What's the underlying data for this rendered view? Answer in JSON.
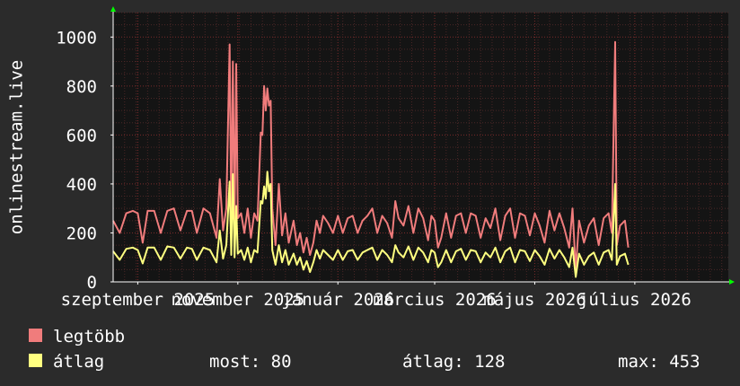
{
  "chart_data": {
    "type": "line",
    "ylabel": "onlinestream.live",
    "ylim": [
      0,
      1100
    ],
    "y_ticks": [
      0,
      200,
      400,
      600,
      800,
      1000
    ],
    "grid": true,
    "x_ticks": [
      {
        "label": "szeptember 2025",
        "t": 0.0
      },
      {
        "label": "november 2025",
        "t": 61.0
      },
      {
        "label": "január 2026",
        "t": 122.0
      },
      {
        "label": "március 2026",
        "t": 181.0
      },
      {
        "label": "május 2026",
        "t": 242.0
      },
      {
        "label": "július 2026",
        "t": 303.0
      }
    ],
    "x_range": [
      -15,
      360
    ],
    "series": [
      {
        "name": "legtöbb",
        "color": "#f07c7c",
        "points": [
          [
            -15,
            250
          ],
          [
            -11,
            200
          ],
          [
            -7,
            280
          ],
          [
            -3,
            290
          ],
          [
            0,
            280
          ],
          [
            3,
            160
          ],
          [
            6,
            290
          ],
          [
            10,
            290
          ],
          [
            14,
            200
          ],
          [
            18,
            290
          ],
          [
            22,
            300
          ],
          [
            26,
            210
          ],
          [
            30,
            290
          ],
          [
            33,
            290
          ],
          [
            36,
            200
          ],
          [
            40,
            300
          ],
          [
            44,
            280
          ],
          [
            48,
            180
          ],
          [
            50,
            420
          ],
          [
            52,
            210
          ],
          [
            54,
            300
          ],
          [
            56,
            970
          ],
          [
            57,
            250
          ],
          [
            58,
            900
          ],
          [
            59,
            220
          ],
          [
            60,
            890
          ],
          [
            61,
            260
          ],
          [
            63,
            280
          ],
          [
            65,
            200
          ],
          [
            67,
            300
          ],
          [
            69,
            180
          ],
          [
            71,
            280
          ],
          [
            73,
            250
          ],
          [
            75,
            610
          ],
          [
            76,
            600
          ],
          [
            77,
            800
          ],
          [
            78,
            700
          ],
          [
            79,
            790
          ],
          [
            80,
            720
          ],
          [
            81,
            740
          ],
          [
            82,
            300
          ],
          [
            84,
            150
          ],
          [
            86,
            400
          ],
          [
            88,
            190
          ],
          [
            90,
            280
          ],
          [
            92,
            160
          ],
          [
            95,
            250
          ],
          [
            97,
            150
          ],
          [
            99,
            200
          ],
          [
            101,
            120
          ],
          [
            103,
            180
          ],
          [
            105,
            110
          ],
          [
            107,
            160
          ],
          [
            109,
            250
          ],
          [
            111,
            200
          ],
          [
            113,
            270
          ],
          [
            116,
            240
          ],
          [
            119,
            200
          ],
          [
            122,
            270
          ],
          [
            125,
            200
          ],
          [
            128,
            260
          ],
          [
            131,
            270
          ],
          [
            134,
            200
          ],
          [
            137,
            250
          ],
          [
            140,
            270
          ],
          [
            143,
            300
          ],
          [
            146,
            200
          ],
          [
            149,
            270
          ],
          [
            152,
            240
          ],
          [
            155,
            180
          ],
          [
            157,
            330
          ],
          [
            159,
            260
          ],
          [
            162,
            230
          ],
          [
            165,
            310
          ],
          [
            168,
            200
          ],
          [
            171,
            300
          ],
          [
            174,
            260
          ],
          [
            177,
            170
          ],
          [
            179,
            270
          ],
          [
            181,
            250
          ],
          [
            183,
            140
          ],
          [
            185,
            180
          ],
          [
            188,
            280
          ],
          [
            191,
            180
          ],
          [
            194,
            270
          ],
          [
            197,
            280
          ],
          [
            200,
            200
          ],
          [
            203,
            280
          ],
          [
            206,
            270
          ],
          [
            209,
            180
          ],
          [
            212,
            260
          ],
          [
            215,
            220
          ],
          [
            218,
            300
          ],
          [
            221,
            170
          ],
          [
            224,
            270
          ],
          [
            227,
            300
          ],
          [
            230,
            180
          ],
          [
            233,
            280
          ],
          [
            236,
            270
          ],
          [
            239,
            190
          ],
          [
            242,
            280
          ],
          [
            245,
            230
          ],
          [
            248,
            160
          ],
          [
            251,
            290
          ],
          [
            254,
            210
          ],
          [
            257,
            280
          ],
          [
            260,
            220
          ],
          [
            263,
            140
          ],
          [
            265,
            300
          ],
          [
            267,
            50
          ],
          [
            269,
            250
          ],
          [
            272,
            160
          ],
          [
            275,
            230
          ],
          [
            278,
            260
          ],
          [
            281,
            150
          ],
          [
            284,
            260
          ],
          [
            287,
            280
          ],
          [
            289,
            200
          ],
          [
            291,
            980
          ],
          [
            292,
            150
          ],
          [
            294,
            230
          ],
          [
            297,
            250
          ],
          [
            299,
            140
          ]
        ]
      },
      {
        "name": "átlag",
        "color": "#ffff80",
        "points": [
          [
            -15,
            125
          ],
          [
            -11,
            90
          ],
          [
            -7,
            135
          ],
          [
            -3,
            140
          ],
          [
            0,
            130
          ],
          [
            3,
            75
          ],
          [
            6,
            140
          ],
          [
            10,
            140
          ],
          [
            14,
            90
          ],
          [
            18,
            145
          ],
          [
            22,
            140
          ],
          [
            26,
            95
          ],
          [
            30,
            140
          ],
          [
            33,
            135
          ],
          [
            36,
            90
          ],
          [
            40,
            140
          ],
          [
            44,
            130
          ],
          [
            48,
            80
          ],
          [
            50,
            210
          ],
          [
            52,
            95
          ],
          [
            54,
            150
          ],
          [
            56,
            410
          ],
          [
            57,
            110
          ],
          [
            58,
            440
          ],
          [
            59,
            100
          ],
          [
            60,
            310
          ],
          [
            61,
            115
          ],
          [
            63,
            130
          ],
          [
            65,
            90
          ],
          [
            67,
            140
          ],
          [
            69,
            80
          ],
          [
            71,
            130
          ],
          [
            73,
            120
          ],
          [
            75,
            330
          ],
          [
            76,
            320
          ],
          [
            77,
            390
          ],
          [
            78,
            340
          ],
          [
            79,
            450
          ],
          [
            80,
            370
          ],
          [
            81,
            400
          ],
          [
            82,
            130
          ],
          [
            84,
            70
          ],
          [
            86,
            150
          ],
          [
            88,
            80
          ],
          [
            90,
            130
          ],
          [
            92,
            70
          ],
          [
            95,
            115
          ],
          [
            97,
            70
          ],
          [
            99,
            100
          ],
          [
            101,
            50
          ],
          [
            103,
            85
          ],
          [
            105,
            40
          ],
          [
            107,
            80
          ],
          [
            109,
            130
          ],
          [
            111,
            95
          ],
          [
            113,
            130
          ],
          [
            116,
            110
          ],
          [
            119,
            90
          ],
          [
            122,
            130
          ],
          [
            125,
            90
          ],
          [
            128,
            125
          ],
          [
            131,
            130
          ],
          [
            134,
            90
          ],
          [
            137,
            120
          ],
          [
            140,
            130
          ],
          [
            143,
            140
          ],
          [
            146,
            90
          ],
          [
            149,
            130
          ],
          [
            152,
            110
          ],
          [
            155,
            80
          ],
          [
            157,
            150
          ],
          [
            159,
            120
          ],
          [
            162,
            100
          ],
          [
            165,
            145
          ],
          [
            168,
            90
          ],
          [
            171,
            140
          ],
          [
            174,
            120
          ],
          [
            177,
            80
          ],
          [
            179,
            130
          ],
          [
            181,
            120
          ],
          [
            183,
            60
          ],
          [
            185,
            80
          ],
          [
            188,
            130
          ],
          [
            191,
            80
          ],
          [
            194,
            125
          ],
          [
            197,
            135
          ],
          [
            200,
            90
          ],
          [
            203,
            130
          ],
          [
            206,
            125
          ],
          [
            209,
            80
          ],
          [
            212,
            120
          ],
          [
            215,
            100
          ],
          [
            218,
            140
          ],
          [
            221,
            80
          ],
          [
            224,
            125
          ],
          [
            227,
            140
          ],
          [
            230,
            80
          ],
          [
            233,
            130
          ],
          [
            236,
            125
          ],
          [
            239,
            85
          ],
          [
            242,
            130
          ],
          [
            245,
            105
          ],
          [
            248,
            70
          ],
          [
            251,
            135
          ],
          [
            254,
            95
          ],
          [
            257,
            130
          ],
          [
            260,
            100
          ],
          [
            263,
            60
          ],
          [
            265,
            140
          ],
          [
            267,
            20
          ],
          [
            269,
            115
          ],
          [
            272,
            70
          ],
          [
            275,
            105
          ],
          [
            278,
            120
          ],
          [
            281,
            70
          ],
          [
            284,
            120
          ],
          [
            287,
            130
          ],
          [
            289,
            90
          ],
          [
            291,
            400
          ],
          [
            292,
            70
          ],
          [
            294,
            105
          ],
          [
            297,
            115
          ],
          [
            299,
            70
          ]
        ]
      }
    ]
  },
  "legend": {
    "items": [
      {
        "label": "legtöbb",
        "color": "#f07c7c"
      },
      {
        "label": "átlag",
        "color": "#ffff80"
      }
    ]
  },
  "stats": {
    "now": "most: 80",
    "avg": "átlag: 128",
    "max": "max: 453"
  }
}
